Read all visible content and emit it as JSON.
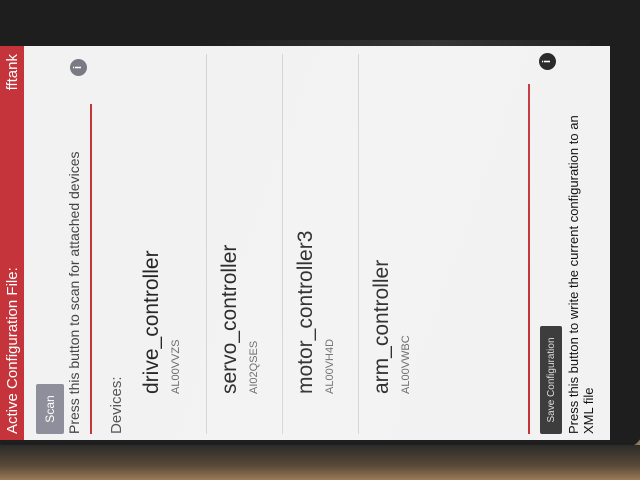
{
  "titlebar": {
    "label": "Active Configuration File:",
    "config_name": "fftank"
  },
  "scan": {
    "button_label": "Scan",
    "help_text": "Press this button to scan for attached devices"
  },
  "info_icon": "i",
  "devices_label": "Devices:",
  "devices": [
    {
      "name": "drive_controller",
      "serial": "AL00VVZS"
    },
    {
      "name": "servo_controller",
      "serial": "AI02QSES"
    },
    {
      "name": "motor_controller3",
      "serial": "AL00VH4D"
    },
    {
      "name": "arm_controller",
      "serial": "AL00VWBC"
    }
  ],
  "save": {
    "button_label": "Save Configuration",
    "help_text": "Press this button to write the current configuration to an XML file"
  },
  "colors": {
    "accent": "#c4343a",
    "button": "#8f8f9b",
    "save_button": "#3d3d3d"
  }
}
